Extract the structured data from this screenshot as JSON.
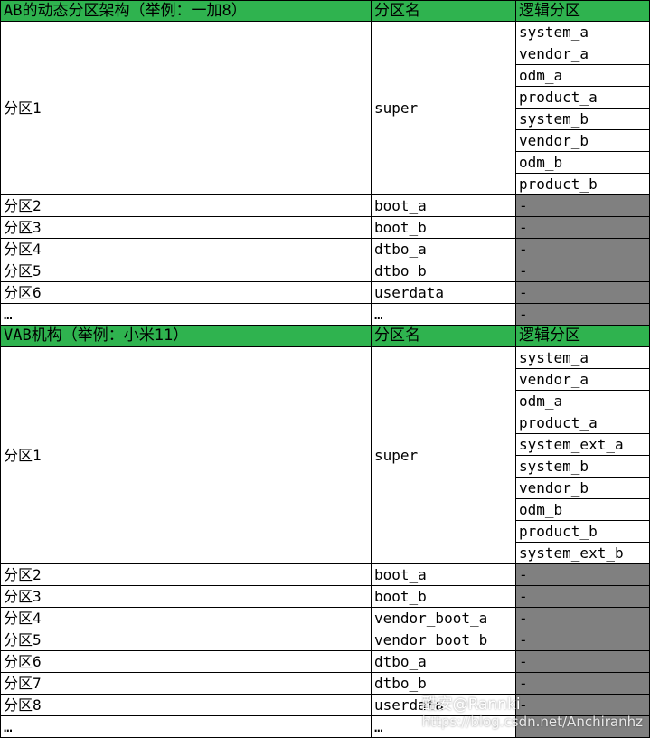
{
  "sections": [
    {
      "header": [
        "AB的动态分区架构（举例：一加8）",
        "分区名",
        "逻辑分区"
      ],
      "super_row": {
        "part": "分区1",
        "name": "super",
        "logical": [
          "system_a",
          "vendor_a",
          "odm_a",
          "product_a",
          "system_b",
          "vendor_b",
          "odm_b",
          "product_b"
        ]
      },
      "rows": [
        {
          "part": "分区2",
          "name": "boot_a",
          "logical": "-"
        },
        {
          "part": "分区3",
          "name": "boot_b",
          "logical": "-"
        },
        {
          "part": "分区4",
          "name": "dtbo_a",
          "logical": "-"
        },
        {
          "part": "分区5",
          "name": "dtbo_b",
          "logical": "-"
        },
        {
          "part": "分区6",
          "name": "userdata",
          "logical": "-"
        },
        {
          "part": "…",
          "name": "…",
          "logical": "-"
        }
      ]
    },
    {
      "header": [
        "VAB机构（举例：小米11）",
        "分区名",
        "逻辑分区"
      ],
      "super_row": {
        "part": "分区1",
        "name": "super",
        "logical": [
          "system_a",
          "vendor_a",
          "odm_a",
          "product_a",
          "system_ext_a",
          "system_b",
          "vendor_b",
          "odm_b",
          "product_b",
          "system_ext_b"
        ]
      },
      "rows": [
        {
          "part": "分区2",
          "name": "boot_a",
          "logical": "-"
        },
        {
          "part": "分区3",
          "name": "boot_b",
          "logical": "-"
        },
        {
          "part": "分区4",
          "name": "vendor_boot_a",
          "logical": "-"
        },
        {
          "part": "分区5",
          "name": "vendor_boot_b",
          "logical": "-"
        },
        {
          "part": "分区6",
          "name": "dtbo_a",
          "logical": "-"
        },
        {
          "part": "分区7",
          "name": "dtbo_b",
          "logical": "-"
        },
        {
          "part": "分区8",
          "name": "userdata",
          "logical": "-"
        },
        {
          "part": "…",
          "name": "…",
          "logical": ""
        }
      ]
    }
  ],
  "watermark": {
    "brand": "酷安@Rannki",
    "url": "https://blog.csdn.net/Anchiranhz"
  },
  "colors": {
    "header_bg": "#2fb34f",
    "filler_bg": "#808080"
  }
}
